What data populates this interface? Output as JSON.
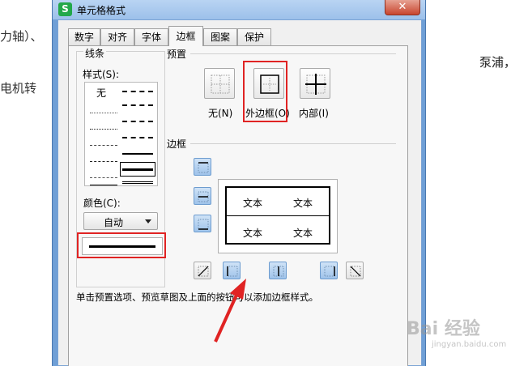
{
  "background_text": [
    "力轴）、",
    "泵浦，",
    "电机转"
  ],
  "dialog": {
    "title": "单元格格式",
    "app_icon": "S",
    "close_label": "✕",
    "tabs": [
      {
        "label": "数字",
        "active": false
      },
      {
        "label": "对齐",
        "active": false
      },
      {
        "label": "字体",
        "active": false
      },
      {
        "label": "边框",
        "active": true
      },
      {
        "label": "图案",
        "active": false
      },
      {
        "label": "保护",
        "active": false
      }
    ],
    "line_group": {
      "title": "线条",
      "style_label": "样式(S):",
      "none_label": "无",
      "color_label": "颜色(C):",
      "color_value": "自动"
    },
    "preset_group": {
      "title": "预置",
      "buttons": [
        {
          "label": "无(N)",
          "icon": "border-none-icon"
        },
        {
          "label": "外边框(O)",
          "icon": "border-outline-icon"
        },
        {
          "label": "内部(I)",
          "icon": "border-inside-icon"
        }
      ]
    },
    "border_group": {
      "title": "边框",
      "preview_cells": [
        "文本",
        "文本",
        "文本",
        "文本"
      ]
    },
    "hint": "单击预置选项、预览草图及上面的按钮可以添加边框样式。"
  },
  "watermark": {
    "main": "Bai 经验",
    "sub": "jingyan.baidu.com"
  },
  "colors": {
    "highlight_red": "#e02323",
    "title_bar": "#9cc0ea",
    "button_blue": "#9fc3ea"
  }
}
